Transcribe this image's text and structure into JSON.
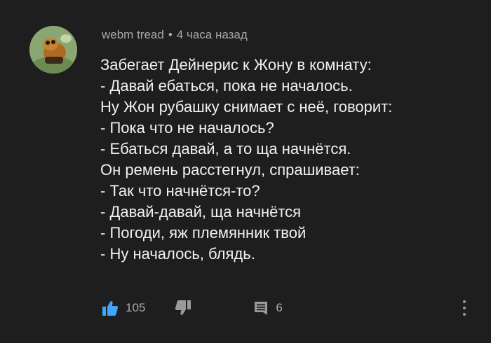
{
  "comment": {
    "author": "webm tread",
    "separator": "•",
    "time": "4 часа назад",
    "lines": [
      "Забегает Дейнерис к Жону в комнату:",
      "- Давай ебаться, пока не началось.",
      "Ну Жон рубашку снимает с неё, говорит:",
      "- Пока что не началось?",
      "- Ебаться давай, а то ща начнётся.",
      "Он ремень расстегнул, спрашивает:",
      "- Так что начнётся-то?",
      "- Давай-давай, ща начнётся",
      "- Погоди, яж племянник твой",
      "- Ну началось, блядь."
    ],
    "likes": "105",
    "replies": "6"
  },
  "icons": {
    "like": "thumbs-up-icon",
    "dislike": "thumbs-down-icon",
    "reply": "comment-icon",
    "more": "more-vertical-icon"
  },
  "colors": {
    "background": "#1e1e1e",
    "text": "#f1f1f1",
    "meta": "#aaaaaa",
    "like_active": "#3ea6ff",
    "icon_muted": "#9a9a9a"
  }
}
